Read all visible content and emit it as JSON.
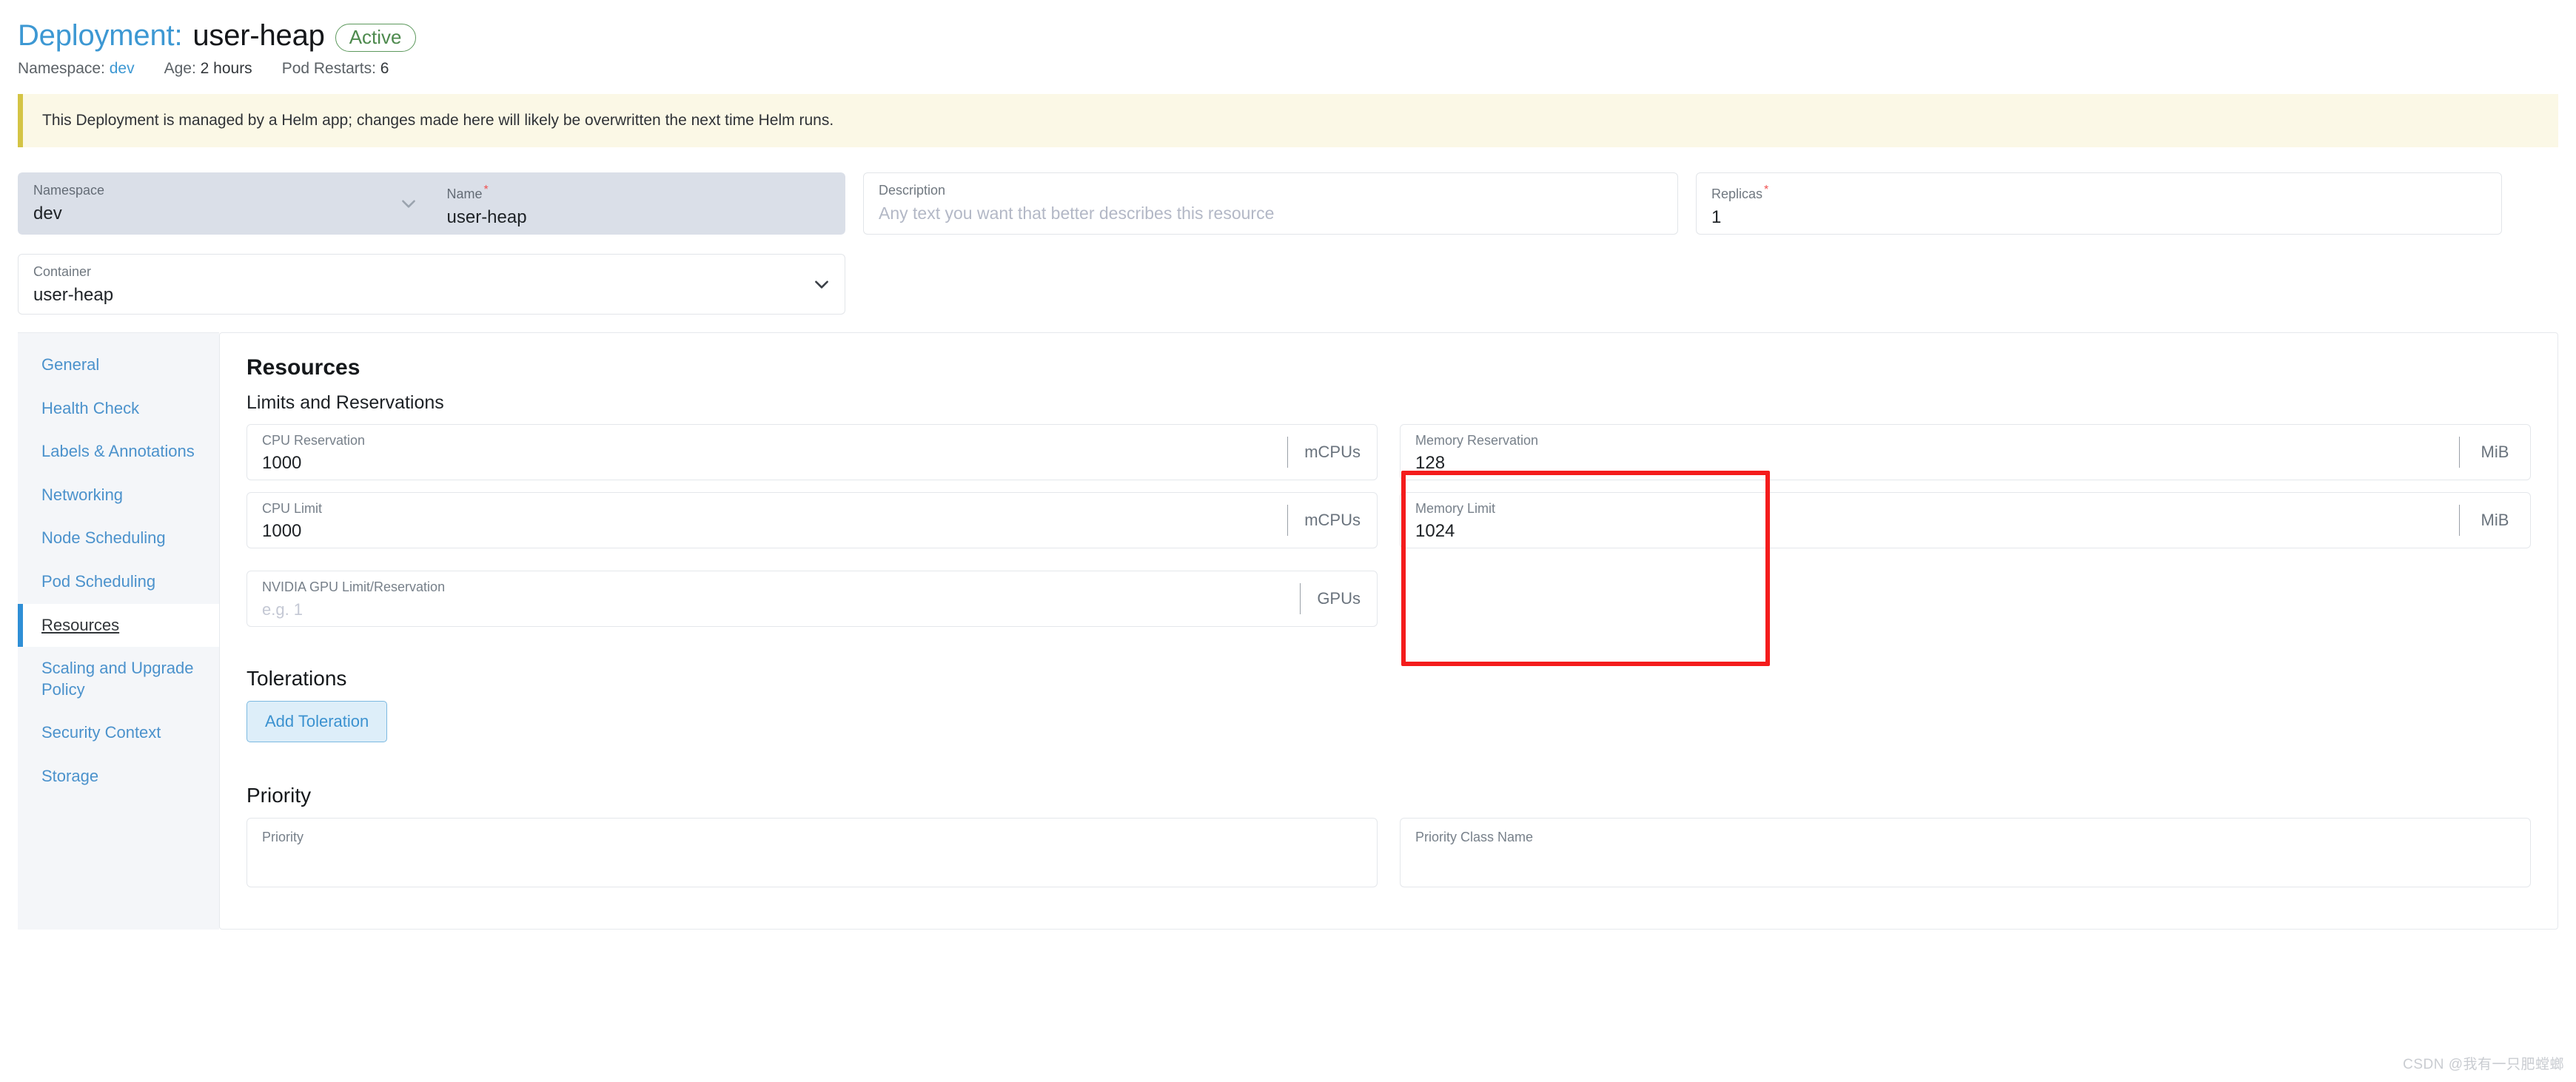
{
  "header": {
    "title_prefix": "Deployment:",
    "title_name": "user-heap",
    "status": "Active",
    "meta": {
      "namespace_label": "Namespace:",
      "namespace_value": "dev",
      "age_label": "Age:",
      "age_value": "2 hours",
      "restarts_label": "Pod Restarts:",
      "restarts_value": "6"
    }
  },
  "banner": {
    "text": "This Deployment is managed by a Helm app; changes made here will likely be overwritten the next time Helm runs.",
    "accent_color": "#d4c445",
    "background_color": "#fbf8e6"
  },
  "form_top": {
    "namespace": {
      "label": "Namespace",
      "value": "dev",
      "icon": "chevron-down-icon"
    },
    "name": {
      "label": "Name",
      "required_marker": "*",
      "value": "user-heap"
    },
    "description": {
      "label": "Description",
      "placeholder": "Any text you want that better describes this resource"
    },
    "replicas": {
      "label": "Replicas",
      "required_marker": "*",
      "value": "1"
    },
    "container": {
      "label": "Container",
      "value": "user-heap",
      "icon": "chevron-down-icon"
    }
  },
  "sidebar": {
    "items": [
      {
        "label": "General",
        "active": false
      },
      {
        "label": "Health Check",
        "active": false
      },
      {
        "label": "Labels & Annotations",
        "active": false
      },
      {
        "label": "Networking",
        "active": false
      },
      {
        "label": "Node Scheduling",
        "active": false
      },
      {
        "label": "Pod Scheduling",
        "active": false
      },
      {
        "label": "Resources",
        "active": true
      },
      {
        "label": "Scaling and Upgrade Policy",
        "active": false
      },
      {
        "label": "Security Context",
        "active": false
      },
      {
        "label": "Storage",
        "active": false
      }
    ],
    "active_accent_color": "#2f8fd6"
  },
  "panel": {
    "title": "Resources",
    "limits_section": {
      "title": "Limits and Reservations",
      "fields": {
        "cpu_reservation": {
          "label": "CPU Reservation",
          "value": "1000",
          "unit": "mCPUs"
        },
        "cpu_limit": {
          "label": "CPU Limit",
          "value": "1000",
          "unit": "mCPUs"
        },
        "memory_reservation": {
          "label": "Memory Reservation",
          "value": "128",
          "unit": "MiB"
        },
        "memory_limit": {
          "label": "Memory Limit",
          "value": "1024",
          "unit": "MiB"
        },
        "gpu": {
          "label": "NVIDIA GPU Limit/Reservation",
          "placeholder": "e.g. 1",
          "unit": "GPUs"
        }
      }
    },
    "tolerations_section": {
      "title": "Tolerations",
      "add_button_label": "Add Toleration"
    },
    "priority_section": {
      "title": "Priority",
      "priority": {
        "label": "Priority",
        "value": ""
      },
      "priority_class_name": {
        "label": "Priority Class Name",
        "value": ""
      }
    }
  },
  "annotation": {
    "color": "#f41c1c",
    "highlights": [
      "Memory Reservation",
      "Memory Limit"
    ]
  },
  "watermark": "CSDN @我有一只肥螳螂"
}
